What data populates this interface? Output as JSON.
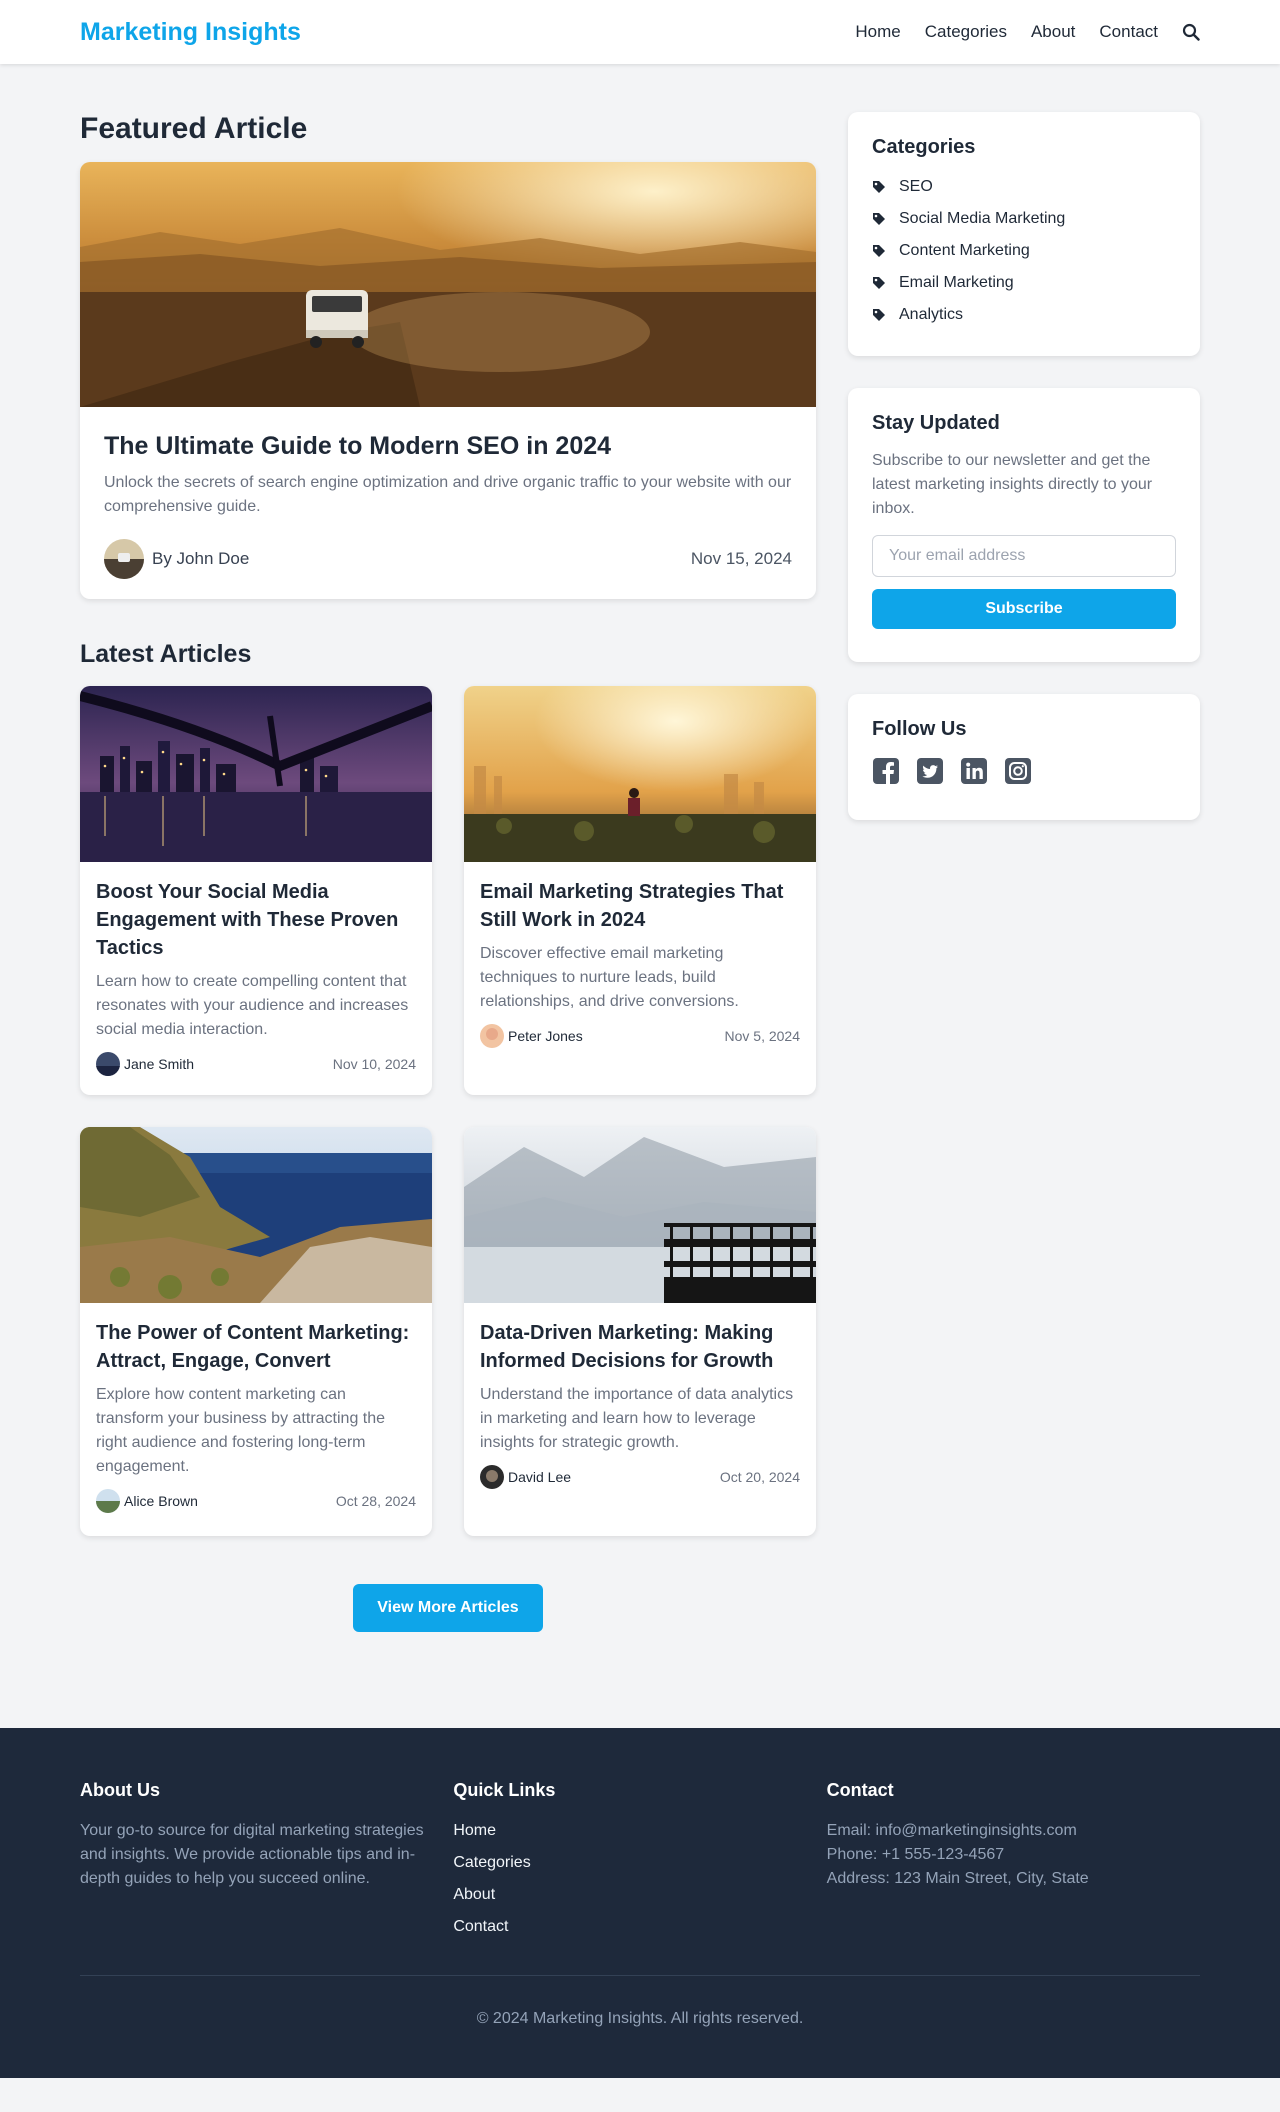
{
  "brand": {
    "name": "Marketing Insights",
    "accent": "#0ea5e9"
  },
  "nav": {
    "items": [
      "Home",
      "Categories",
      "About",
      "Contact"
    ],
    "search_icon": "search-icon"
  },
  "featured": {
    "section_title": "Featured Article",
    "title": "The Ultimate Guide to Modern SEO in 2024",
    "excerpt": "Unlock the secrets of search engine optimization and drive organic traffic to your website with our comprehensive guide.",
    "author": "By John Doe",
    "date": "Nov 15, 2024"
  },
  "latest": {
    "section_title": "Latest Articles",
    "articles": [
      {
        "title": "Boost Your Social Media Engagement with These Proven Tactics",
        "excerpt": "Learn how to create compelling content that resonates with your audience and increases social media interaction.",
        "author": "Jane Smith",
        "date": "Nov 10, 2024"
      },
      {
        "title": "Email Marketing Strategies That Still Work in 2024",
        "excerpt": "Discover effective email marketing techniques to nurture leads, build relationships, and drive conversions.",
        "author": "Peter Jones",
        "date": "Nov 5, 2024"
      },
      {
        "title": "The Power of Content Marketing: Attract, Engage, Convert",
        "excerpt": "Explore how content marketing can transform your business by attracting the right audience and fostering long-term engagement.",
        "author": "Alice Brown",
        "date": "Oct 28, 2024"
      },
      {
        "title": "Data-Driven Marketing: Making Informed Decisions for Growth",
        "excerpt": "Understand the importance of data analytics in marketing and learn how to leverage insights for strategic growth.",
        "author": "David Lee",
        "date": "Oct 20, 2024"
      }
    ],
    "more_button": "View More Articles"
  },
  "sidebar": {
    "categories": {
      "title": "Categories",
      "items": [
        "SEO",
        "Social Media Marketing",
        "Content Marketing",
        "Email Marketing",
        "Analytics"
      ]
    },
    "newsletter": {
      "title": "Stay Updated",
      "text": "Subscribe to our newsletter and get the latest marketing insights directly to your inbox.",
      "placeholder": "Your email address",
      "button": "Subscribe"
    },
    "follow": {
      "title": "Follow Us",
      "icons": [
        "facebook-icon",
        "twitter-icon",
        "linkedin-icon",
        "instagram-icon"
      ]
    }
  },
  "footer": {
    "about": {
      "title": "About Us",
      "text": "Your go-to source for digital marketing strategies and insights. We provide actionable tips and in-depth guides to help you succeed online."
    },
    "quick_links": {
      "title": "Quick Links",
      "items": [
        "Home",
        "Categories",
        "About",
        "Contact"
      ]
    },
    "contact": {
      "title": "Contact",
      "email": "Email: info@marketinginsights.com",
      "phone": "Phone: +1 555-123-4567",
      "address": "Address: 123 Main Street, City, State"
    },
    "copyright": "© 2024 Marketing Insights. All rights reserved."
  }
}
